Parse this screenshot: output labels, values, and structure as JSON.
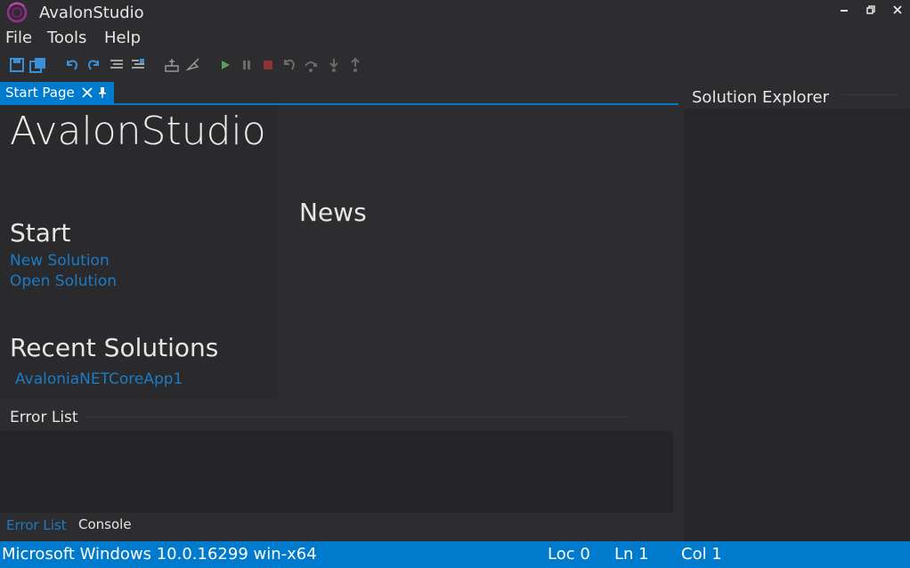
{
  "window": {
    "title": "AvalonStudio"
  },
  "menu": {
    "file": "File",
    "tools": "Tools",
    "help": "Help"
  },
  "toolbar": {
    "icons": [
      "save-icon",
      "save-all-icon",
      "undo-icon",
      "redo-icon",
      "comment-icon",
      "uncomment-icon",
      "build-icon",
      "clean-icon",
      "play-icon",
      "pause-icon",
      "stop-icon",
      "restart-icon",
      "step-over-icon",
      "step-into-icon",
      "step-out-icon"
    ]
  },
  "tabs": {
    "start_page": "Start Page"
  },
  "start_page": {
    "brand": "AvalonStudio",
    "start_heading": "Start",
    "new_solution": "New Solution",
    "open_solution": "Open Solution",
    "recent_heading": "Recent Solutions",
    "recent_items": [
      "AvaloniaNETCoreApp1"
    ],
    "news_heading": "News"
  },
  "error_list": {
    "title": "Error List",
    "tabs": [
      "Error List",
      "Console"
    ]
  },
  "solution_explorer": {
    "title": "Solution Explorer"
  },
  "status_bar": {
    "os": "Microsoft Windows 10.0.16299  win-x64",
    "loc": "Loc 0",
    "ln": "Ln 1",
    "col": "Col 1"
  },
  "colors": {
    "accent": "#007acc",
    "link": "#1b7bc4",
    "background": "#2d2d30",
    "logo": "#9b2d8f"
  }
}
